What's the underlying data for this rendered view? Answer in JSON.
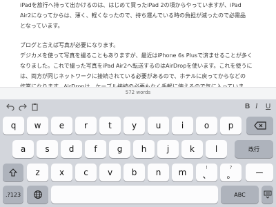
{
  "editor": {
    "paragraph1": [
      "iPadを旅行へ持って出かけるのは、はじめて買ったiPad 2の頃からやっていますが、iPad",
      "Air2になってからは、薄く、軽くなったので、持ち運んでいる時の負担が減ったので必需品",
      "となっています。"
    ],
    "paragraph2": [
      "ブログと言えば写真が必要になります。",
      "デジカメを使って写真を撮ることもありますが、最近はiPhone 6s Plusで済ませることが多く",
      "なりました。これで撮った写真をiPad Air2へ転送するのはAirDropを使います。これを使うに",
      "は、両方が同じネットワークに接続されている必要があるので、ホテルに戻ってからなどの",
      "作業になります。AirDropは、ケーブル接続の必要もなく手軽に使えるので気に入っていま"
    ]
  },
  "status": {
    "word_count": "572 words"
  },
  "shortcut_bar": {
    "undo_icon": "undo-icon",
    "redo_icon": "redo-icon",
    "paste_icon": "paste-icon",
    "bold": "B",
    "italic": "I",
    "underline": "U"
  },
  "keyboard": {
    "row1": [
      "q",
      "w",
      "e",
      "r",
      "t",
      "y",
      "u",
      "i",
      "o",
      "p"
    ],
    "row2": [
      "a",
      "s",
      "d",
      "f",
      "g",
      "h",
      "j",
      "k",
      "l"
    ],
    "row3": [
      "z",
      "x",
      "c",
      "v",
      "b",
      "n",
      "m"
    ],
    "return_label": "改行",
    "delete_icon": "backspace-icon",
    "shift_icon": "shift-arrow-icon",
    "punct_excl": {
      "top": "!",
      "main": "、"
    },
    "punct_q": {
      "top": "?",
      "main": "。"
    },
    "dash": "ー",
    "numbers_label": ".?123",
    "globe_icon": "globe-icon",
    "abc_label": "ABC",
    "hide_keyboard_icon": "keyboard-hide-icon"
  },
  "colors": {
    "keyboard_bg": "#d3d6dc",
    "key_light": "#fcfcfd",
    "key_dark": "#aeb3bc"
  }
}
